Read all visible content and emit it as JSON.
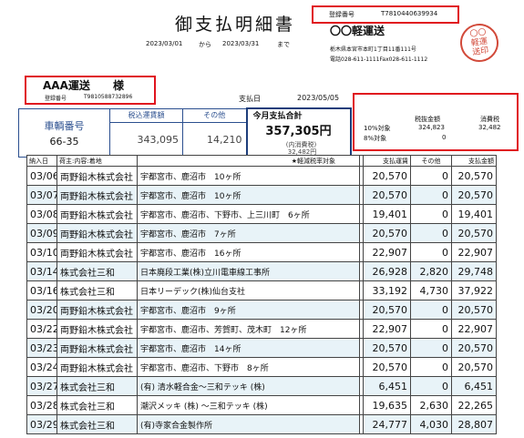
{
  "title": "御支払明細書",
  "period": {
    "from": "2023/03/01",
    "from_label": "から",
    "to": "2023/03/31",
    "to_label": "まで"
  },
  "issuer": {
    "registration_label": "登録番号",
    "registration_number": "T7810440639934",
    "name": "〇〇軽運送",
    "address": "栃木県本宮市本町1丁目11番111号",
    "phone": "電話028-611-1111Fax028-611-1112",
    "stamp_text": "〇〇軽運送印"
  },
  "recipient": {
    "name": "AAA運送",
    "honorific": "様",
    "registration_label": "登録番号",
    "registration_number": "T9810588732896"
  },
  "payment": {
    "label": "支払日",
    "date": "2023/05/05"
  },
  "summary": {
    "vehicle_label": "車輌番号",
    "vehicle_number": "66-35",
    "fare_label": "税込運賃額",
    "fare_value": "343,095",
    "other_label": "その他",
    "other_value": "14,210",
    "total_label": "今月支払合計",
    "total_value": "357,305円",
    "tax_included_label": "(内消費税)",
    "tax_included_value": "32,482円"
  },
  "tax_table": {
    "col_amount": "税抜金額",
    "col_tax": "消費税",
    "rows": [
      {
        "label": "10%対象",
        "amount": "324,823",
        "tax": "32,482"
      },
      {
        "label": "8%対象",
        "amount": "0",
        "tax": ""
      }
    ]
  },
  "table": {
    "headers": [
      "納入日",
      "荷主:内容:着地",
      "★軽減税率対象",
      "支払運賃",
      "その他",
      "支払金額"
    ],
    "rows": [
      {
        "date": "03/06",
        "company": "両野鉛木株式会社",
        "dest": "宇都宮市、鹿沼市　10ヶ所",
        "fare": "20,570",
        "other": "0",
        "total": "20,570"
      },
      {
        "date": "03/07",
        "company": "両野鉛木株式会社",
        "dest": "宇都宮市、鹿沼市　10ヶ所",
        "fare": "20,570",
        "other": "0",
        "total": "20,570"
      },
      {
        "date": "03/08",
        "company": "両野鉛木株式会社",
        "dest": "宇都宮市、鹿沼市、下野市、上三川町　6ヶ所",
        "fare": "19,401",
        "other": "0",
        "total": "19,401"
      },
      {
        "date": "03/09",
        "company": "両野鉛木株式会社",
        "dest": "宇都宮市、鹿沼市　7ヶ所",
        "fare": "20,570",
        "other": "0",
        "total": "20,570"
      },
      {
        "date": "03/10",
        "company": "両野鉛木株式会社",
        "dest": "宇都宮市、鹿沼市　16ヶ所",
        "fare": "22,907",
        "other": "0",
        "total": "22,907"
      },
      {
        "date": "03/14",
        "company": "株式会社三和",
        "dest": "日本廃段工業(株)立川電車線工事所",
        "fare": "26,928",
        "other": "2,820",
        "total": "29,748"
      },
      {
        "date": "03/16",
        "company": "株式会社三和",
        "dest": "日本リーデック(株)仙台支社",
        "fare": "33,192",
        "other": "4,730",
        "total": "37,922"
      },
      {
        "date": "03/20",
        "company": "両野鉛木株式会社",
        "dest": "宇都宮市、鹿沼市　9ヶ所",
        "fare": "20,570",
        "other": "0",
        "total": "20,570"
      },
      {
        "date": "03/22",
        "company": "両野鉛木株式会社",
        "dest": "宇都宮市、鹿沼市、芳賀町、茂木町　12ヶ所",
        "fare": "22,907",
        "other": "0",
        "total": "22,907"
      },
      {
        "date": "03/23",
        "company": "両野鉛木株式会社",
        "dest": "宇都宮市、鹿沼市　14ヶ所",
        "fare": "20,570",
        "other": "0",
        "total": "20,570"
      },
      {
        "date": "03/24",
        "company": "両野鉛木株式会社",
        "dest": "宇都宮市、鹿沼市、下野市　8ヶ所",
        "fare": "20,570",
        "other": "0",
        "total": "20,570"
      },
      {
        "date": "03/27",
        "company": "株式会社三和",
        "dest": "(有) 清水軽合金～三和テッキ (株)",
        "fare": "6,451",
        "other": "0",
        "total": "6,451"
      },
      {
        "date": "03/28",
        "company": "株式会社三和",
        "dest": "潮沢メッキ (株) ～三和テッキ (株)",
        "fare": "19,635",
        "other": "2,630",
        "total": "22,265"
      },
      {
        "date": "03/29",
        "company": "株式会社三和",
        "dest": "(有)寺家合金製作所",
        "fare": "24,777",
        "other": "4,030",
        "total": "28,807"
      }
    ]
  }
}
